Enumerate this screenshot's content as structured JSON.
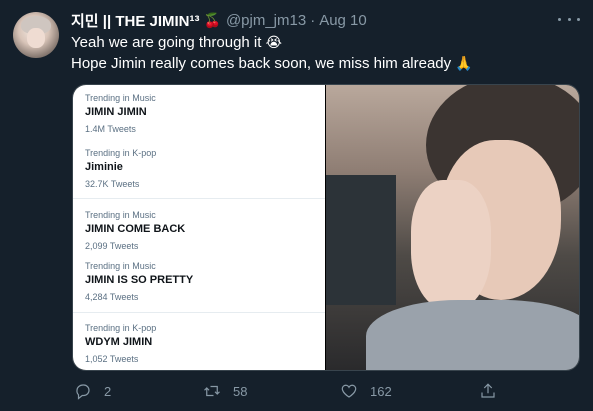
{
  "tweet": {
    "display_name": "지민 || THE JIMIN¹³",
    "cherry": "🍒",
    "handle": "@pjm_jm13",
    "separator": "·",
    "date": "Aug 10",
    "line1": "Yeah we are going through it",
    "line1_emoji": "😭",
    "line2": "Hope Jimin really comes back soon, we miss him already",
    "line2_emoji": "🙏"
  },
  "trends": [
    {
      "category": "Trending in Music",
      "name": "JIMIN JIMIN",
      "count": "1.4M Tweets"
    },
    {
      "category": "Trending in K-pop",
      "name": "Jiminie",
      "count": "32.7K Tweets"
    },
    {
      "category": "Trending in Music",
      "name": "JIMIN COME BACK",
      "count": "2,099 Tweets"
    },
    {
      "category": "Trending in Music",
      "name": "JIMIN IS SO PRETTY",
      "count": "4,284 Tweets"
    },
    {
      "category": "Trending in K-pop",
      "name": "WDYM JIMIN",
      "count": "1,052 Tweets"
    }
  ],
  "actions": {
    "reply_count": "2",
    "retweet_count": "58",
    "like_count": "162"
  },
  "colors": {
    "background": "#15202b",
    "secondary_text": "#8899a6",
    "border": "#38444d"
  },
  "icons": {
    "more": "more-dots-icon",
    "reply": "reply-icon",
    "retweet": "retweet-icon",
    "like": "heart-icon",
    "share": "share-icon"
  }
}
